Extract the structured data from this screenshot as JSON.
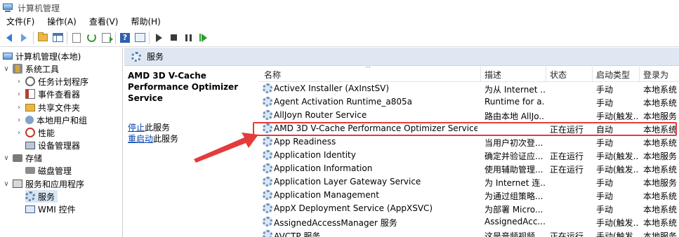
{
  "title": "计算机管理",
  "menu": [
    "文件(F)",
    "操作(A)",
    "查看(V)",
    "帮助(H)"
  ],
  "toolbar_icons": [
    "back-icon",
    "forward-icon",
    "up-folder-icon",
    "console-tree-icon",
    "properties-doc-icon",
    "refresh-icon",
    "export-list-icon",
    "help-icon",
    "show-hide-icon",
    "start-service-icon",
    "stop-service-icon",
    "pause-service-icon",
    "resume-service-icon"
  ],
  "tree": {
    "root": "计算机管理(本地)",
    "system_tools": "系统工具",
    "task_scheduler": "任务计划程序",
    "event_viewer": "事件查看器",
    "shared_folders": "共享文件夹",
    "local_users": "本地用户和组",
    "performance": "性能",
    "device_manager": "设备管理器",
    "storage": "存储",
    "disk_management": "磁盘管理",
    "services_apps": "服务和应用程序",
    "services": "服务",
    "wmi": "WMI 控件"
  },
  "header": "服务",
  "description": {
    "title": "AMD 3D V-Cache Performance Optimizer Service",
    "stop_link": "停止",
    "stop_rest": "此服务",
    "restart_link": "重启动",
    "restart_rest": "此服务"
  },
  "columns": {
    "name": "名称",
    "desc": "描述",
    "status": "状态",
    "startup": "启动类型",
    "logon": "登录为"
  },
  "rows": [
    {
      "name": "ActiveX Installer (AxInstSV)",
      "desc": "为从 Internet ...",
      "status": "",
      "startup": "手动",
      "logon": "本地系统"
    },
    {
      "name": "Agent Activation Runtime_a805a",
      "desc": "Runtime for a...",
      "status": "",
      "startup": "手动",
      "logon": "本地系统"
    },
    {
      "name": "AllJoyn Router Service",
      "desc": "路由本地 AllJo...",
      "status": "",
      "startup": "手动(触发...",
      "logon": "本地服务"
    },
    {
      "name": "AMD 3D V-Cache Performance Optimizer Service",
      "desc": "",
      "status": "正在运行",
      "startup": "自动",
      "logon": "本地系统"
    },
    {
      "name": "App Readiness",
      "desc": "当用户初次登...",
      "status": "",
      "startup": "手动",
      "logon": "本地系统"
    },
    {
      "name": "Application Identity",
      "desc": "确定并验证应...",
      "status": "正在运行",
      "startup": "手动(触发...",
      "logon": "本地服务"
    },
    {
      "name": "Application Information",
      "desc": "使用辅助管理...",
      "status": "正在运行",
      "startup": "手动(触发...",
      "logon": "本地系统"
    },
    {
      "name": "Application Layer Gateway Service",
      "desc": "为 Internet 连...",
      "status": "",
      "startup": "手动",
      "logon": "本地服务"
    },
    {
      "name": "Application Management",
      "desc": "为通过组策略...",
      "status": "",
      "startup": "手动",
      "logon": "本地系统"
    },
    {
      "name": "AppX Deployment Service (AppXSVC)",
      "desc": "为部署 Micro...",
      "status": "",
      "startup": "手动",
      "logon": "本地系统"
    },
    {
      "name": "AssignedAccessManager 服务",
      "desc": "AssignedAcc...",
      "status": "",
      "startup": "手动(触发...",
      "logon": "本地系统"
    },
    {
      "name": "AVCTP 服务",
      "desc": "这是音频视频...",
      "status": "正在运行",
      "startup": "手动(触发...",
      "logon": "本地服务"
    }
  ],
  "colors": {
    "highlight_border": "#e43b3b",
    "header_band": "#dfe8f2",
    "link": "#0645ad"
  }
}
